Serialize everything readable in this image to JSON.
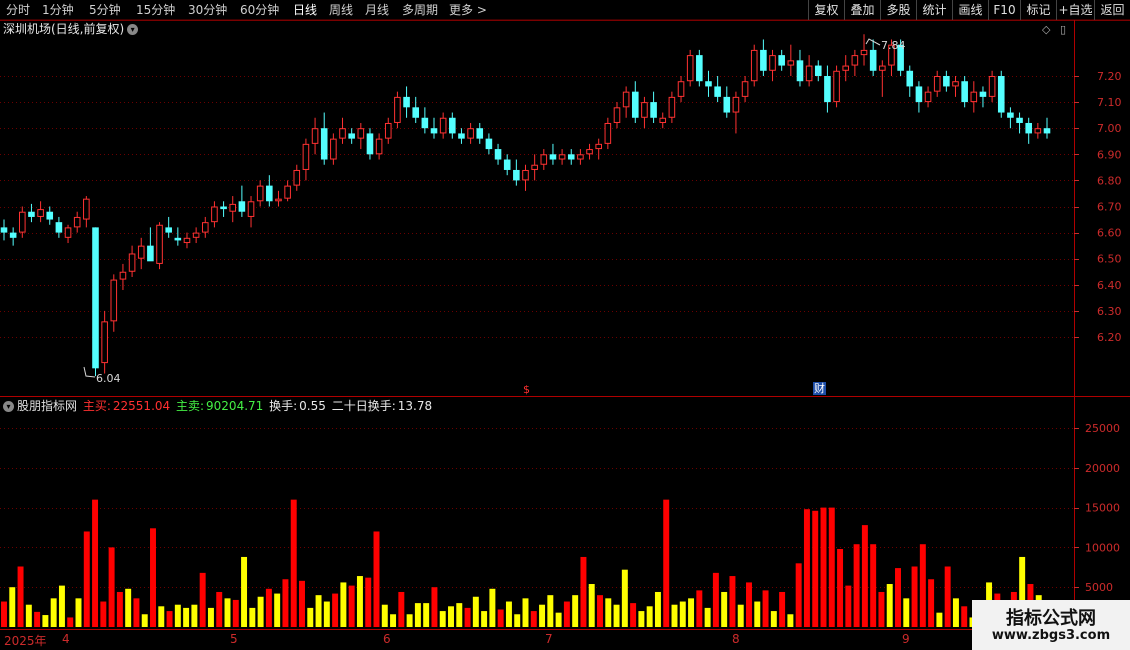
{
  "toolbar": {
    "periods": [
      "分时",
      "1分钟",
      "5分钟",
      "15分钟",
      "30分钟",
      "60分钟",
      "日线",
      "周线",
      "月线",
      "多周期",
      "更多 >"
    ],
    "active_period": "日线",
    "buttons": [
      "复权",
      "叠加",
      "多股",
      "统计",
      "画线",
      "F10",
      "标记",
      "+自选",
      "返回"
    ]
  },
  "price_panel": {
    "title": "深圳机场(日线,前复权)",
    "title_toggle_icon": "chevron-down-icon",
    "right_icons": [
      "diamond-icon",
      "layout-icon"
    ],
    "high_label": "7.84",
    "low_label": "6.04",
    "dividend_marker": "$",
    "finance_marker": "财"
  },
  "indicator_panel": {
    "name": "股朋指标网",
    "toggle_icon": "chevron-down-icon",
    "buy_label": "主买:",
    "buy_value": "22551.04",
    "sell_label": "主卖:",
    "sell_value": "90204.71",
    "turnover_label": "换手:",
    "turnover_value": "0.55",
    "turnover20_label": "二十日换手:",
    "turnover20_value": "13.78"
  },
  "date_axis": {
    "year_label": "2025年",
    "month_labels": [
      "4",
      "5",
      "6",
      "7",
      "8",
      "9"
    ]
  },
  "watermark": {
    "line1": "指标公式网",
    "line2": "www.zbgs3.com"
  },
  "colors": {
    "up": "#ff3232",
    "down": "#54ffff",
    "axis": "#cc2b2b",
    "vol_red": "#ff0000",
    "vol_yellow": "#ffff00"
  },
  "chart_data": [
    {
      "type": "candlestick",
      "title": "深圳机场(日线,前复权)",
      "y_ticks": [
        6.2,
        6.3,
        6.4,
        6.5,
        6.6,
        6.7,
        6.8,
        6.9,
        7.0,
        7.1,
        7.2
      ],
      "ylim": [
        6.02,
        7.4
      ],
      "annotations": [
        {
          "label": "7.84",
          "kind": "high"
        },
        {
          "label": "6.04",
          "kind": "low"
        }
      ],
      "ohlc": [
        [
          6.62,
          6.65,
          6.57,
          6.6
        ],
        [
          6.6,
          6.62,
          6.55,
          6.58
        ],
        [
          6.6,
          6.7,
          6.58,
          6.68
        ],
        [
          6.68,
          6.71,
          6.64,
          6.66
        ],
        [
          6.66,
          6.72,
          6.64,
          6.69
        ],
        [
          6.68,
          6.7,
          6.63,
          6.65
        ],
        [
          6.64,
          6.66,
          6.58,
          6.6
        ],
        [
          6.58,
          6.63,
          6.56,
          6.62
        ],
        [
          6.62,
          6.68,
          6.6,
          6.66
        ],
        [
          6.65,
          6.74,
          6.62,
          6.73
        ],
        [
          6.62,
          6.62,
          6.05,
          6.08
        ],
        [
          6.1,
          6.3,
          6.06,
          6.26
        ],
        [
          6.26,
          6.44,
          6.22,
          6.42
        ],
        [
          6.42,
          6.48,
          6.38,
          6.45
        ],
        [
          6.45,
          6.55,
          6.43,
          6.52
        ],
        [
          6.5,
          6.58,
          6.46,
          6.55
        ],
        [
          6.55,
          6.62,
          6.5,
          6.49
        ],
        [
          6.48,
          6.64,
          6.46,
          6.63
        ],
        [
          6.62,
          6.66,
          6.58,
          6.6
        ],
        [
          6.58,
          6.62,
          6.55,
          6.57
        ],
        [
          6.56,
          6.6,
          6.54,
          6.58
        ],
        [
          6.58,
          6.62,
          6.56,
          6.6
        ],
        [
          6.6,
          6.66,
          6.58,
          6.64
        ],
        [
          6.64,
          6.72,
          6.62,
          6.7
        ],
        [
          6.7,
          6.72,
          6.66,
          6.69
        ],
        [
          6.68,
          6.74,
          6.64,
          6.71
        ],
        [
          6.72,
          6.78,
          6.66,
          6.68
        ],
        [
          6.66,
          6.74,
          6.62,
          6.72
        ],
        [
          6.72,
          6.8,
          6.7,
          6.78
        ],
        [
          6.78,
          6.82,
          6.7,
          6.72
        ],
        [
          6.72,
          6.76,
          6.7,
          6.73
        ],
        [
          6.73,
          6.8,
          6.72,
          6.78
        ],
        [
          6.78,
          6.86,
          6.76,
          6.84
        ],
        [
          6.84,
          6.96,
          6.8,
          6.94
        ],
        [
          6.94,
          7.04,
          6.9,
          7.0
        ],
        [
          7.0,
          7.06,
          6.86,
          6.88
        ],
        [
          6.88,
          6.98,
          6.86,
          6.96
        ],
        [
          6.96,
          7.04,
          6.94,
          7.0
        ],
        [
          6.98,
          7.0,
          6.94,
          6.96
        ],
        [
          6.96,
          7.02,
          6.92,
          7.0
        ],
        [
          6.98,
          7.0,
          6.88,
          6.9
        ],
        [
          6.9,
          6.98,
          6.88,
          6.96
        ],
        [
          6.96,
          7.04,
          6.94,
          7.02
        ],
        [
          7.02,
          7.14,
          7.0,
          7.12
        ],
        [
          7.12,
          7.16,
          7.04,
          7.08
        ],
        [
          7.08,
          7.12,
          7.02,
          7.04
        ],
        [
          7.04,
          7.08,
          6.98,
          7.0
        ],
        [
          7.0,
          7.04,
          6.96,
          6.98
        ],
        [
          6.98,
          7.06,
          6.96,
          7.04
        ],
        [
          7.04,
          7.06,
          6.96,
          6.98
        ],
        [
          6.98,
          7.0,
          6.94,
          6.96
        ],
        [
          6.96,
          7.02,
          6.94,
          7.0
        ],
        [
          7.0,
          7.02,
          6.94,
          6.96
        ],
        [
          6.96,
          6.98,
          6.9,
          6.92
        ],
        [
          6.92,
          6.94,
          6.86,
          6.88
        ],
        [
          6.88,
          6.9,
          6.82,
          6.84
        ],
        [
          6.84,
          6.88,
          6.78,
          6.8
        ],
        [
          6.8,
          6.86,
          6.76,
          6.84
        ],
        [
          6.84,
          6.9,
          6.8,
          6.86
        ],
        [
          6.86,
          6.92,
          6.84,
          6.9
        ],
        [
          6.9,
          6.94,
          6.86,
          6.88
        ],
        [
          6.88,
          6.92,
          6.86,
          6.9
        ],
        [
          6.9,
          6.92,
          6.86,
          6.88
        ],
        [
          6.88,
          6.92,
          6.86,
          6.9
        ],
        [
          6.9,
          6.94,
          6.88,
          6.92
        ],
        [
          6.92,
          6.96,
          6.88,
          6.94
        ],
        [
          6.94,
          7.04,
          6.92,
          7.02
        ],
        [
          7.02,
          7.1,
          7.0,
          7.08
        ],
        [
          7.08,
          7.16,
          7.04,
          7.14
        ],
        [
          7.14,
          7.18,
          7.02,
          7.04
        ],
        [
          7.04,
          7.12,
          7.0,
          7.1
        ],
        [
          7.1,
          7.14,
          7.02,
          7.04
        ],
        [
          7.02,
          7.06,
          7.0,
          7.04
        ],
        [
          7.04,
          7.14,
          7.02,
          7.12
        ],
        [
          7.12,
          7.2,
          7.1,
          7.18
        ],
        [
          7.18,
          7.3,
          7.16,
          7.28
        ],
        [
          7.28,
          7.3,
          7.16,
          7.18
        ],
        [
          7.18,
          7.22,
          7.12,
          7.16
        ],
        [
          7.16,
          7.2,
          7.1,
          7.12
        ],
        [
          7.12,
          7.16,
          7.04,
          7.06
        ],
        [
          7.06,
          7.14,
          6.98,
          7.12
        ],
        [
          7.12,
          7.2,
          7.1,
          7.18
        ],
        [
          7.18,
          7.32,
          7.16,
          7.3
        ],
        [
          7.3,
          7.34,
          7.2,
          7.22
        ],
        [
          7.22,
          7.3,
          7.18,
          7.28
        ],
        [
          7.28,
          7.3,
          7.22,
          7.24
        ],
        [
          7.24,
          7.32,
          7.2,
          7.26
        ],
        [
          7.26,
          7.3,
          7.16,
          7.18
        ],
        [
          7.18,
          7.28,
          7.16,
          7.24
        ],
        [
          7.24,
          7.26,
          7.18,
          7.2
        ],
        [
          7.2,
          7.24,
          7.06,
          7.1
        ],
        [
          7.1,
          7.24,
          7.08,
          7.22
        ],
        [
          7.22,
          7.28,
          7.18,
          7.24
        ],
        [
          7.24,
          7.3,
          7.2,
          7.28
        ],
        [
          7.28,
          7.36,
          7.24,
          7.3
        ],
        [
          7.3,
          7.34,
          7.2,
          7.22
        ],
        [
          7.22,
          7.26,
          7.12,
          7.24
        ],
        [
          7.24,
          7.34,
          7.2,
          7.32
        ],
        [
          7.32,
          7.34,
          7.2,
          7.22
        ],
        [
          7.22,
          7.24,
          7.12,
          7.16
        ],
        [
          7.16,
          7.18,
          7.06,
          7.1
        ],
        [
          7.1,
          7.16,
          7.08,
          7.14
        ],
        [
          7.14,
          7.22,
          7.12,
          7.2
        ],
        [
          7.2,
          7.22,
          7.14,
          7.16
        ],
        [
          7.16,
          7.2,
          7.12,
          7.18
        ],
        [
          7.18,
          7.2,
          7.08,
          7.1
        ],
        [
          7.1,
          7.18,
          7.06,
          7.14
        ],
        [
          7.14,
          7.16,
          7.08,
          7.12
        ],
        [
          7.12,
          7.22,
          7.1,
          7.2
        ],
        [
          7.2,
          7.22,
          7.04,
          7.06
        ],
        [
          7.06,
          7.08,
          7.0,
          7.04
        ],
        [
          7.04,
          7.06,
          6.98,
          7.02
        ],
        [
          7.02,
          7.04,
          6.94,
          6.98
        ],
        [
          6.98,
          7.02,
          6.96,
          7.0
        ],
        [
          7.0,
          7.04,
          6.96,
          6.98
        ]
      ]
    },
    {
      "type": "bar",
      "title": "股朋指标网",
      "y_ticks": [
        5000,
        10000,
        15000,
        20000,
        25000
      ],
      "ylim": [
        0,
        28000
      ],
      "series": [
        {
          "name": "主买",
          "color": "red"
        },
        {
          "name": "主卖",
          "color": "yellow"
        }
      ],
      "values": [
        3200,
        5000,
        7600,
        2800,
        1900,
        1500,
        3600,
        5200,
        1200,
        3600,
        12000,
        16000,
        3200,
        10000,
        4400,
        4800,
        3600,
        1600,
        12400,
        2600,
        2000,
        2800,
        2400,
        2800,
        6800,
        2400,
        4400,
        3600,
        3400,
        8800,
        2400,
        3800,
        4800,
        4200,
        6000,
        16000,
        5800,
        2400,
        4000,
        3200,
        4200,
        5600,
        5200,
        6400,
        6200,
        12000,
        2800,
        1600,
        4400,
        1600,
        3000,
        3000,
        5000,
        2000,
        2600,
        3000,
        2400,
        3800,
        2000,
        4800,
        2200,
        3200,
        1600,
        3600,
        2000,
        2800,
        4000,
        1800,
        3200,
        4000,
        8800,
        5400,
        4000,
        3600,
        2800,
        7200,
        3000,
        2000,
        2600,
        4400,
        16000,
        2800,
        3200,
        3600,
        4600,
        2400,
        6800,
        4400,
        6400,
        2800,
        5600,
        3200,
        4600,
        2000,
        4400,
        1600,
        8000,
        14800,
        14600,
        15000,
        15000,
        9800,
        5200,
        10400,
        12800,
        10400,
        4400,
        5400,
        7400,
        3600,
        7600,
        10400,
        6000,
        1800,
        7600,
        3600,
        2600,
        1200,
        3200,
        5600,
        4200,
        1800,
        4400,
        8800,
        5400,
        4000,
        1200
      ]
    }
  ]
}
